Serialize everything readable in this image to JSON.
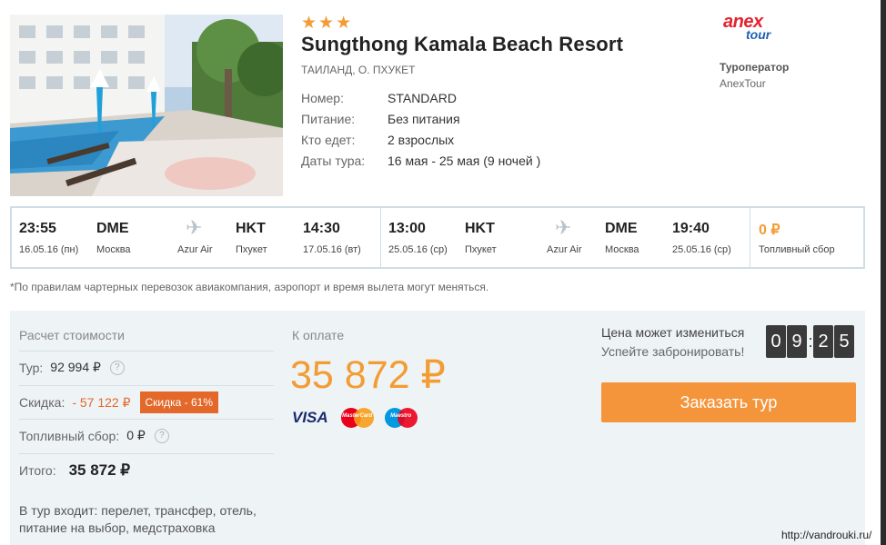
{
  "hotel": {
    "stars": "★★★",
    "name": "Sungthong Kamala Beach Resort",
    "location": "ТАИЛАНД, О. ПХУКЕТ",
    "details": [
      {
        "label": "Номер:",
        "value": "STANDARD"
      },
      {
        "label": "Питание:",
        "value": "Без питания"
      },
      {
        "label": "Кто едет:",
        "value": "2 взрослых"
      },
      {
        "label": "Даты тура:",
        "value": "16 мая - 25 мая (9 ночей )"
      }
    ]
  },
  "operator": {
    "logo_top": "anex",
    "logo_bottom": "tour",
    "label": "Туроператор",
    "name": "AnexTour"
  },
  "flights": {
    "outbound": {
      "dep_time": "23:55",
      "dep_date": "16.05.16 (пн)",
      "dep_code": "DME",
      "dep_city": "Москва",
      "airline": "Azur Air",
      "arr_code": "HKT",
      "arr_city": "Пхукет",
      "arr_time": "14:30",
      "arr_date": "17.05.16 (вт)"
    },
    "return": {
      "dep_time": "13:00",
      "dep_date": "25.05.16 (ср)",
      "dep_code": "HKT",
      "dep_city": "Пхукет",
      "airline": "Azur Air",
      "arr_code": "DME",
      "arr_city": "Москва",
      "arr_time": "19:40",
      "arr_date": "25.05.16 (ср)"
    },
    "fuel": {
      "value": "0 ₽",
      "label": "Топливный сбор"
    },
    "plane_icon": "airplane-icon"
  },
  "note": "*По правилам чартерных перевозок авиакомпания, аэропорт и время вылета могут меняться.",
  "pricing": {
    "title": "Расчет стоимости",
    "tour_label": "Тур:",
    "tour_value": "92 994 ₽",
    "discount_label": "Скидка:",
    "discount_value": "- 57 122 ₽",
    "discount_badge": "Скидка - 61%",
    "fuel_label": "Топливный сбор:",
    "fuel_value": "0 ₽",
    "total_label": "Итого:",
    "total_value": "35 872 ₽",
    "help_glyph": "?",
    "includes": "В тур входит: перелет, трансфер, отель, питание на выбор, медстраховка"
  },
  "payment": {
    "label": "К оплате",
    "amount": "35 872 ₽",
    "cards": {
      "visa": "VISA",
      "mastercard": "MasterCard",
      "maestro": "Maestro"
    }
  },
  "booking": {
    "warning": "Цена может измениться",
    "hurry": "Успейте забронировать!",
    "timer": {
      "d1": "0",
      "d2": "9",
      "d3": "2",
      "d4": "5",
      "sep": ":"
    },
    "button": "Заказать тур"
  },
  "watermark": "http://vandrouki.ru/",
  "colors": {
    "accent": "#f4953c",
    "discount": "#e4682a",
    "background": "#eef3f6"
  }
}
